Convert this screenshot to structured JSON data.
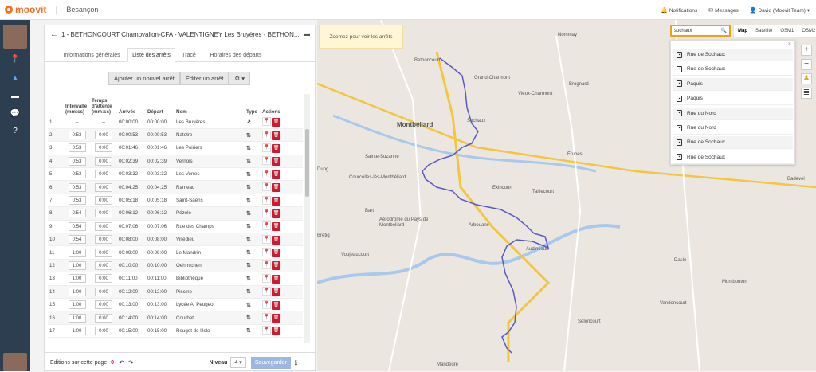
{
  "topbar": {
    "brand": "moovit",
    "city": "Besançon",
    "notifications": "Notifications",
    "messages": "Messages",
    "user": "David (Moovit Team)"
  },
  "panel": {
    "title": "1 - BETHONCOURT Champvallon-CFA - VALENTIGNEY Les Bruyères - BETHON...",
    "tabs": [
      "Informations générales",
      "Liste des arrêts",
      "Tracé",
      "Horaires des départs"
    ],
    "btn_add": "Ajouter un nouvel arrêt",
    "btn_edit": "Editer un arrêt",
    "headers": [
      "Intervalle (mm:ss)",
      "Temps d'attente (mm:ss)",
      "Arrivée",
      "Départ",
      "Nom",
      "Type",
      "Actions"
    ],
    "rows": [
      {
        "n": "1",
        "iv": "--",
        "wt": "--",
        "arr": "00:00:00",
        "dep": "00:00:00",
        "name": "Les Bruyères",
        "type": "↗"
      },
      {
        "n": "2",
        "iv": "0:53",
        "wt": "0:00",
        "arr": "00:00:53",
        "dep": "00:00:53",
        "name": "Natetre",
        "type": "⇅"
      },
      {
        "n": "3",
        "iv": "0:53",
        "wt": "0:00",
        "arr": "00:01:46",
        "dep": "00:01:46",
        "name": "Les Poiriers",
        "type": "⇅"
      },
      {
        "n": "4",
        "iv": "0:53",
        "wt": "0:00",
        "arr": "00:02:39",
        "dep": "00:02:39",
        "name": "Vernois",
        "type": "⇅"
      },
      {
        "n": "5",
        "iv": "0:53",
        "wt": "0:00",
        "arr": "00:03:32",
        "dep": "00:03:32",
        "name": "Les Verres",
        "type": "⇅"
      },
      {
        "n": "6",
        "iv": "0:53",
        "wt": "0:00",
        "arr": "00:04:25",
        "dep": "00:04:25",
        "name": "Rameau",
        "type": "⇅"
      },
      {
        "n": "7",
        "iv": "0:53",
        "wt": "0:00",
        "arr": "00:05:18",
        "dep": "00:05:18",
        "name": "Saint-Saëns",
        "type": "⇅"
      },
      {
        "n": "8",
        "iv": "0:54",
        "wt": "0:00",
        "arr": "00:06:12",
        "dep": "00:06:12",
        "name": "Pézole",
        "type": "⇅"
      },
      {
        "n": "9",
        "iv": "0:54",
        "wt": "0:00",
        "arr": "00:07:06",
        "dep": "00:07:06",
        "name": "Rue des Champs",
        "type": "⇅"
      },
      {
        "n": "10",
        "iv": "0:54",
        "wt": "0:00",
        "arr": "00:08:00",
        "dep": "00:08:00",
        "name": "Villedieu",
        "type": "⇅"
      },
      {
        "n": "11",
        "iv": "1:00",
        "wt": "0:00",
        "arr": "00:09:00",
        "dep": "00:09:00",
        "name": "Le Mandrin",
        "type": "⇅"
      },
      {
        "n": "12",
        "iv": "1:00",
        "wt": "0:00",
        "arr": "00:10:00",
        "dep": "00:10:00",
        "name": "Oehmichen",
        "type": "⇅"
      },
      {
        "n": "13",
        "iv": "1:00",
        "wt": "0:00",
        "arr": "00:11:00",
        "dep": "00:11:00",
        "name": "Bibliothèque",
        "type": "⇅"
      },
      {
        "n": "14",
        "iv": "1:00",
        "wt": "0:00",
        "arr": "00:12:00",
        "dep": "00:12:00",
        "name": "Piscine",
        "type": "⇅"
      },
      {
        "n": "15",
        "iv": "1:00",
        "wt": "0:00",
        "arr": "00:13:00",
        "dep": "00:13:00",
        "name": "Lycée A. Peugeot",
        "type": "⇅"
      },
      {
        "n": "16",
        "iv": "1:00",
        "wt": "0:00",
        "arr": "00:14:00",
        "dep": "00:14:00",
        "name": "Courbet",
        "type": "⇅"
      },
      {
        "n": "17",
        "iv": "1:00",
        "wt": "0:00",
        "arr": "00:15:00",
        "dep": "00:15:00",
        "name": "Rouget de l'Isle",
        "type": "⇅"
      }
    ],
    "footer_label": "Editions sur cette page:",
    "footer_count": "0",
    "level_label": "Niveau",
    "level_value": "4",
    "save": "Sauvegarder"
  },
  "map": {
    "zoom_msg": "Zoomez pour voir les arrêts",
    "search_value": "sochaux",
    "types": [
      "Map",
      "Satellite",
      "OSM1",
      "OSM2"
    ],
    "results": [
      "Rue de Sochaux",
      "Rue de Sochaux",
      "Paquis",
      "Paquis",
      "Rue du Nord",
      "Rue du Nord",
      "Rue de Sochaux",
      "Rue de Sochaux"
    ],
    "labels": [
      {
        "t": "Nommay"
      },
      {
        "t": "Grand-Charmont"
      },
      {
        "t": "Vieux-Charmont"
      },
      {
        "t": "Brognard"
      },
      {
        "t": "Sochaux"
      },
      {
        "t": "Montbéliard"
      },
      {
        "t": "Sainte-Suzanne"
      },
      {
        "t": "Courcelles-lès-Montbéliard"
      },
      {
        "t": "Exincourt"
      },
      {
        "t": "Taillecourt"
      },
      {
        "t": "Étupes"
      },
      {
        "t": "Aérodrome du Pays de Montbéliard"
      },
      {
        "t": "Arbouans"
      },
      {
        "t": "Audincourt"
      },
      {
        "t": "Bart"
      },
      {
        "t": "Voujeaucourt"
      },
      {
        "t": "Seloncourt"
      },
      {
        "t": "Mandeure"
      },
      {
        "t": "Vandoncourt"
      },
      {
        "t": "Dasle"
      },
      {
        "t": "Badevel"
      },
      {
        "t": "Montbouton"
      },
      {
        "t": "Bethoncourt"
      },
      {
        "t": "Dung"
      },
      {
        "t": "Bretig"
      }
    ]
  }
}
